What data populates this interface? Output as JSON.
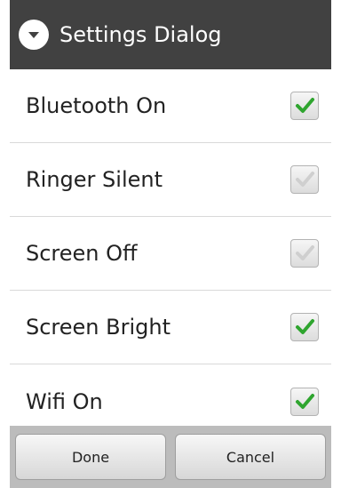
{
  "dialog": {
    "title": "Settings Dialog",
    "title_icon": "chevron-down-circle-icon"
  },
  "settings": [
    {
      "label": "Bluetooth On",
      "checked": true,
      "check_color": "#2fa52f"
    },
    {
      "label": "Ringer Silent",
      "checked": false
    },
    {
      "label": "Screen Off",
      "checked": false
    },
    {
      "label": "Screen Bright",
      "checked": true,
      "check_color": "#2fa52f"
    },
    {
      "label": "Wifi On",
      "checked": true,
      "check_color": "#2fa52f"
    }
  ],
  "buttons": {
    "done_label": "Done",
    "cancel_label": "Cancel"
  },
  "colors": {
    "titlebar_bg": "#414141",
    "checked_mark": "#2fa52f",
    "unchecked_mark": "#cfcfcf"
  }
}
